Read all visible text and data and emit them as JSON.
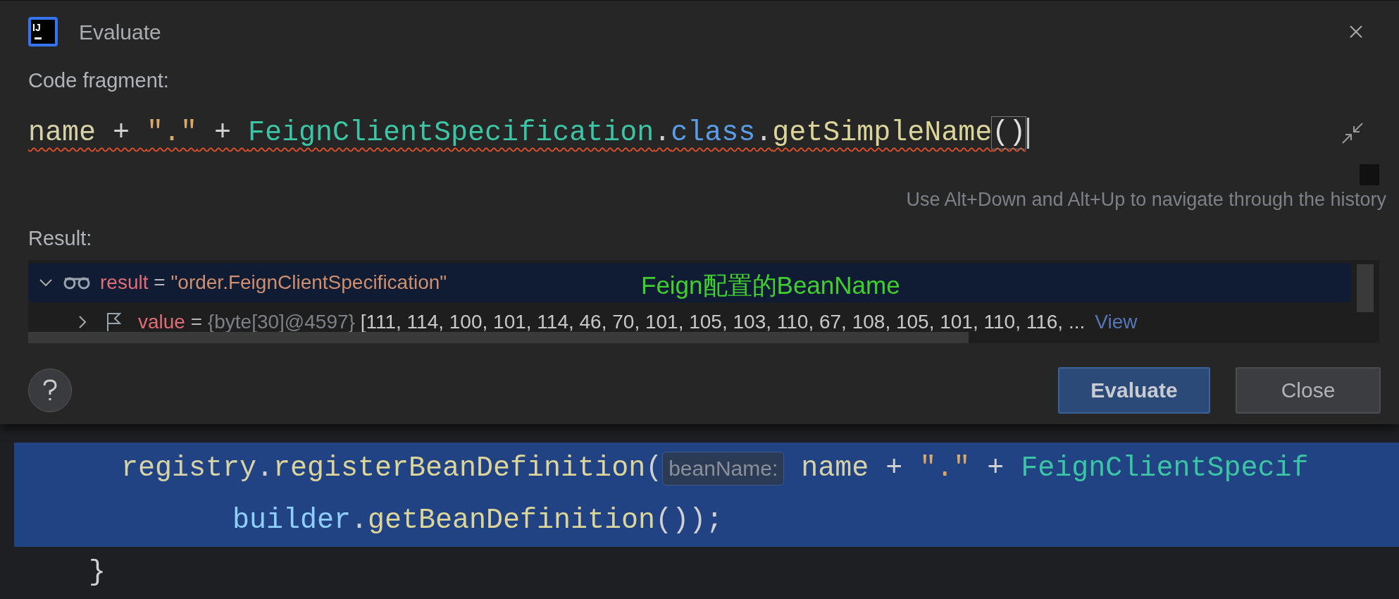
{
  "window": {
    "title": "Evaluate",
    "logo_text": "IJ"
  },
  "code_fragment": {
    "label": "Code fragment:",
    "tokens": [
      {
        "kind": "ident",
        "text": "name"
      },
      {
        "kind": "op",
        "text": " + "
      },
      {
        "kind": "string",
        "text": "\".\""
      },
      {
        "kind": "op",
        "text": " + "
      },
      {
        "kind": "type",
        "text": "FeignClientSpecification"
      },
      {
        "kind": "op",
        "text": "."
      },
      {
        "kind": "keyword",
        "text": "class"
      },
      {
        "kind": "op",
        "text": "."
      },
      {
        "kind": "method",
        "text": "getSimpleName"
      },
      {
        "kind": "paren",
        "text": "()"
      }
    ],
    "error": true,
    "hint": "Use Alt+Down and Alt+Up to navigate through the history"
  },
  "result": {
    "label": "Result:",
    "rows": [
      {
        "kind": "watch",
        "expanded": true,
        "selected": true,
        "name": "result",
        "eq": "=",
        "type": "",
        "value": "\"order.FeignClientSpecification\"",
        "link": ""
      },
      {
        "kind": "flag",
        "expanded": false,
        "selected": false,
        "name": "value",
        "eq": "=",
        "type": "{byte[30]@4597}",
        "value": "[111, 114, 100, 101, 114, 46, 70, 101, 105, 103, 110, 67, 108, 105, 101, 110, 116, ...",
        "link": "View"
      }
    ]
  },
  "annotation": "Feign配置的BeanName",
  "buttons": [
    {
      "label": "Evaluate",
      "default": true
    },
    {
      "label": "Close",
      "default": false
    }
  ],
  "editor": {
    "lines": [
      {
        "selected": true,
        "tokens": [
          {
            "kind": "ident",
            "text": "registry"
          },
          {
            "kind": "op",
            "text": "."
          },
          {
            "kind": "method",
            "text": "registerBeanDefinition"
          },
          {
            "kind": "op",
            "text": "("
          },
          {
            "kind": "inlay",
            "text": "beanName:"
          },
          {
            "kind": "ident",
            "text": " name"
          },
          {
            "kind": "op",
            "text": " + "
          },
          {
            "kind": "string",
            "text": "\".\""
          },
          {
            "kind": "op",
            "text": " + "
          },
          {
            "kind": "type",
            "text": "FeignClientSpecif"
          }
        ]
      },
      {
        "selected": true,
        "tokens": [
          {
            "kind": "var",
            "text": "builder"
          },
          {
            "kind": "op",
            "text": "."
          },
          {
            "kind": "method",
            "text": "getBeanDefinition"
          },
          {
            "kind": "op",
            "text": "());"
          }
        ]
      },
      {
        "selected": false,
        "tokens": [
          {
            "kind": "op",
            "text": "}"
          }
        ]
      }
    ]
  }
}
